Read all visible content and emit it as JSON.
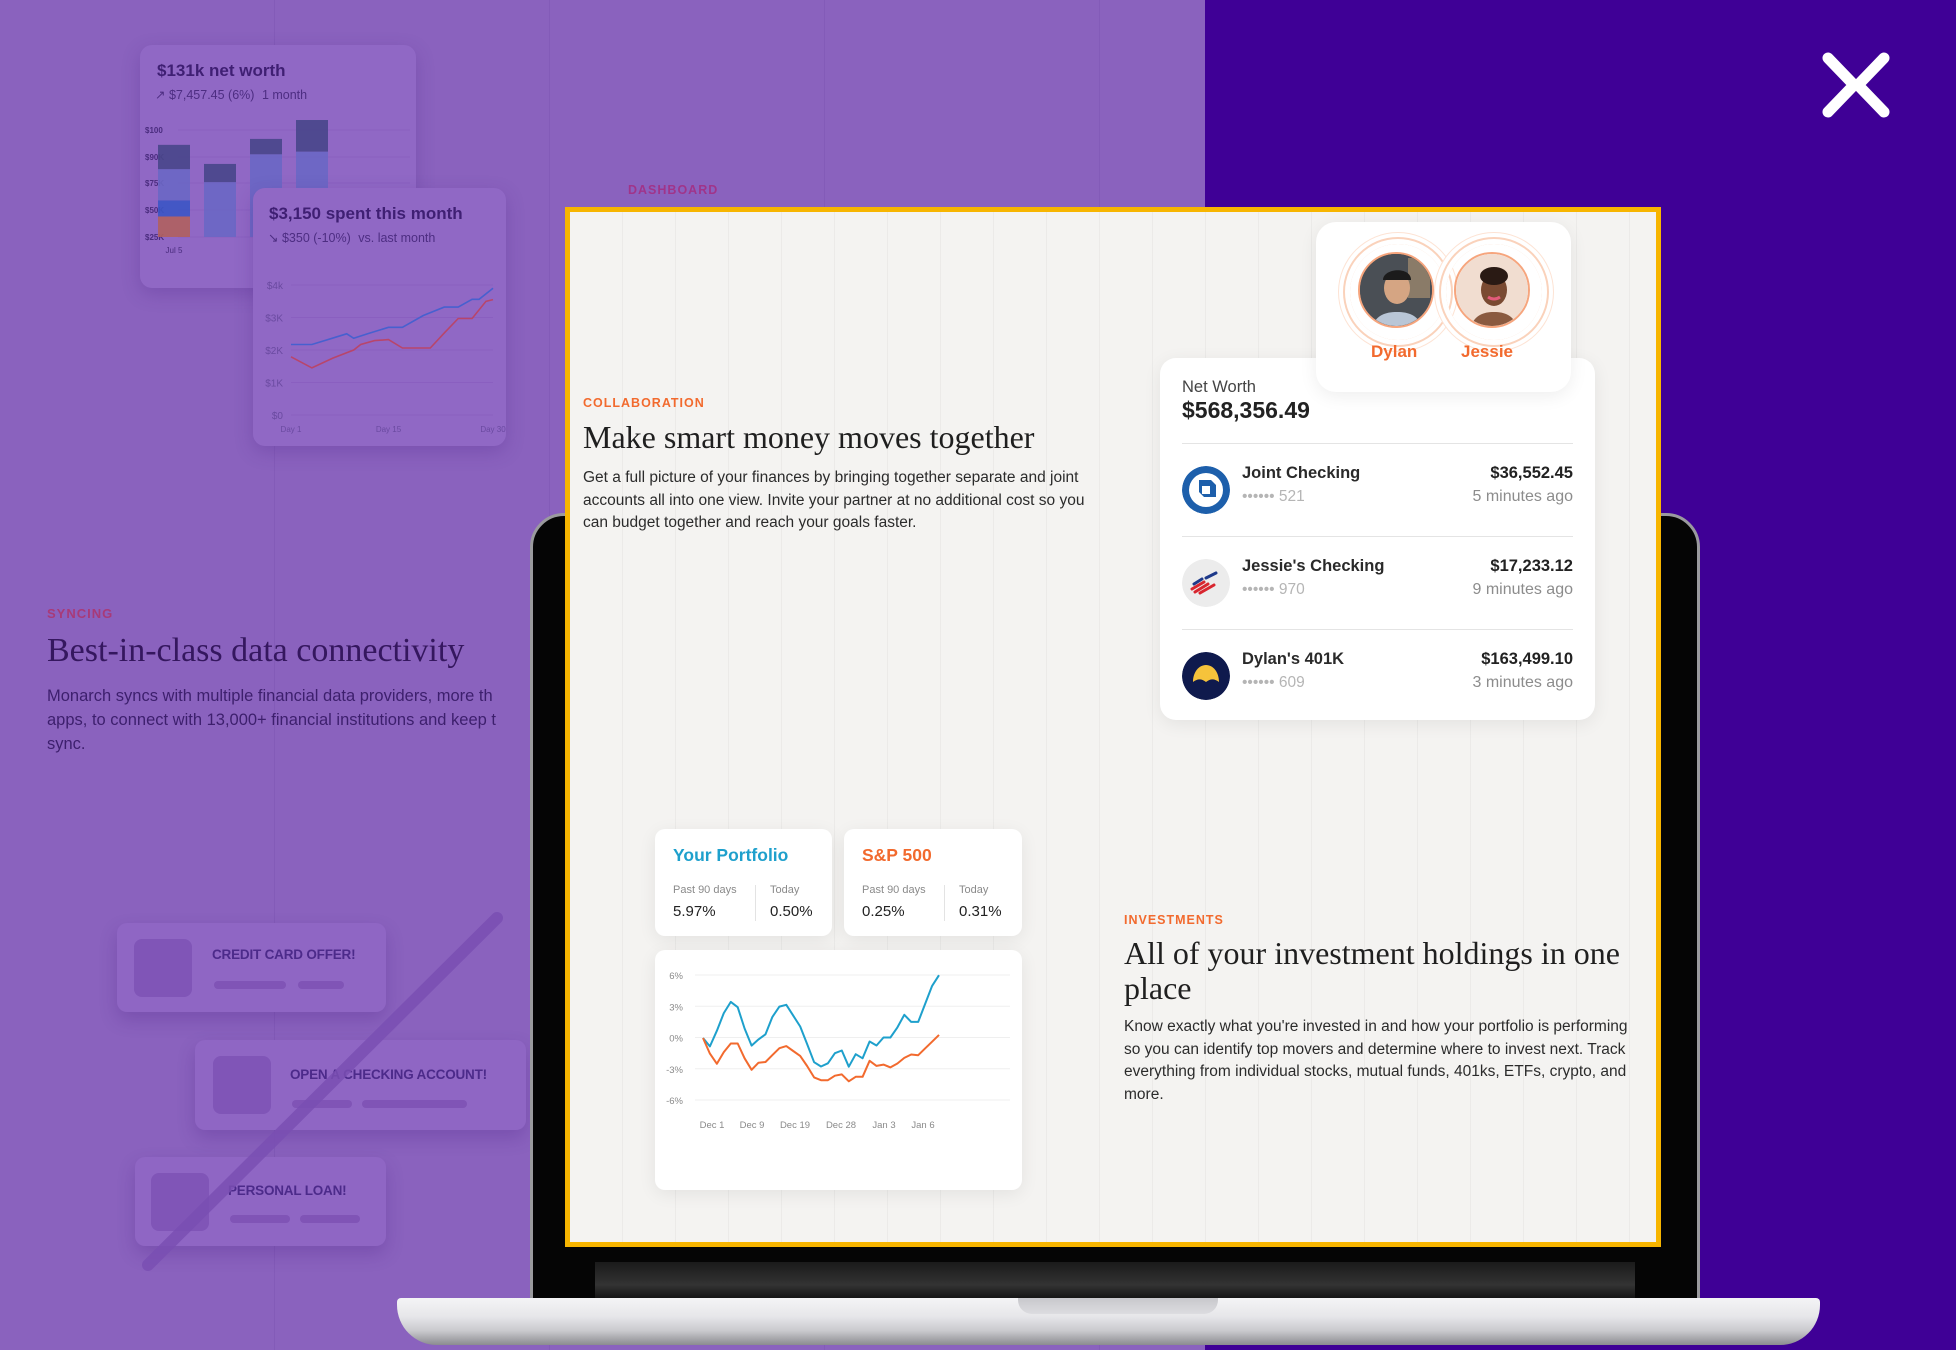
{
  "logo": {
    "name": "x-logo-icon",
    "color": "#ffffff"
  },
  "colors": {
    "left_background": "#8a62be",
    "right_background": "#3f0096",
    "highlight_border": "#f7b500",
    "accent_orange": "#f26a2e",
    "portfolio_blue": "#1ea0cc"
  },
  "background_page": {
    "net_worth_card": {
      "title": "$131k net worth",
      "change": "$7,457.45 (6%)",
      "period": "1 month",
      "change_icon": "arrow-up-right-icon"
    },
    "spent_card": {
      "title": "$3,150 spent this month",
      "change": "$350 (-10%)",
      "period": "vs. last month",
      "change_icon": "arrow-down-right-icon"
    },
    "dashboard_label": "DASHBOARD",
    "syncing": {
      "eyebrow": "SYNCING",
      "heading": "Best-in-class data connectivity",
      "body_lines": [
        "Monarch syncs with multiple financial data providers, more th",
        "apps, to connect with 13,000+ financial institutions and keep t",
        "sync."
      ]
    },
    "ads": [
      {
        "label": "CREDIT CARD OFFER!"
      },
      {
        "label": "OPEN A CHECKING ACCOUNT!"
      },
      {
        "label": "PERSONAL LOAN!"
      }
    ]
  },
  "screen": {
    "collaboration": {
      "eyebrow": "COLLABORATION",
      "heading": "Make smart money moves together",
      "body": "Get a full picture of your finances by bringing together separate and joint accounts all into one view. Invite your partner at no additional cost so you can budget together and reach your goals faster."
    },
    "partners": [
      {
        "name": "Dylan"
      },
      {
        "name": "Jessie"
      }
    ],
    "net_worth": {
      "label": "Net Worth",
      "value": "$568,356.49",
      "accounts": [
        {
          "name": "Joint Checking",
          "mask": "•••••• 521",
          "amount": "$36,552.45",
          "updated": "5 minutes ago",
          "icon": "chase-bank-icon"
        },
        {
          "name": "Jessie's Checking",
          "mask": "•••••• 970",
          "amount": "$17,233.12",
          "updated": "9 minutes ago",
          "icon": "bank-of-america-icon"
        },
        {
          "name": "Dylan's 401K",
          "mask": "•••••• 609",
          "amount": "$163,499.10",
          "updated": "3 minutes ago",
          "icon": "retirement-provider-icon"
        }
      ]
    },
    "performance": [
      {
        "title": "Your Portfolio",
        "color": "#1ea0cc",
        "past_label": "Past 90 days",
        "past_value": "5.97%",
        "today_label": "Today",
        "today_value": "0.50%"
      },
      {
        "title": "S&P 500",
        "color": "#f26a2e",
        "past_label": "Past 90 days",
        "past_value": "0.25%",
        "today_label": "Today",
        "today_value": "0.31%"
      }
    ],
    "investments": {
      "eyebrow": "INVESTMENTS",
      "heading": "All of your investment holdings in one place",
      "body": "Know exactly what you're invested in and how your portfolio is performing so you can identify top movers and determine where to invest next. Track everything from individual stocks, mutual funds, 401ks, ETFs, crypto, and more."
    }
  },
  "chart_data": [
    {
      "type": "line",
      "title": "",
      "x_ticks": [
        "Dec 1",
        "Dec 9",
        "Dec 19",
        "Dec 28",
        "Jan 3",
        "Jan 6"
      ],
      "y_ticks": [
        "6%",
        "3%",
        "0%",
        "-3%",
        "-6%"
      ],
      "ylim": [
        -6,
        6
      ],
      "grid": true,
      "series": [
        {
          "color": "#1ea0cc",
          "values": [
            -0.05,
            -0.85,
            0.65,
            2.34,
            3.42,
            2.91,
            0.86,
            -0.78,
            -0.18,
            0.31,
            1.98,
            2.97,
            3.14,
            2.1,
            1.06,
            -0.62,
            -2.37,
            -2.78,
            -2.48,
            -1.51,
            -1.25,
            -2.8,
            -1.6,
            -2.0,
            -0.38,
            -0.77,
            0,
            0,
            0.97,
            2.18,
            1.5,
            1.5,
            3.22,
            4.95,
            5.98
          ]
        },
        {
          "color": "#f26a2e",
          "values": [
            -0.05,
            -1.55,
            -2.52,
            -1.4,
            -0.58,
            -0.58,
            -2.0,
            -3.1,
            -2.42,
            -2.35,
            -1.69,
            -1.03,
            -0.83,
            -1.3,
            -1.77,
            -2.74,
            -3.83,
            -4.1,
            -4.1,
            -3.67,
            -3.54,
            -4.2,
            -3.77,
            -3.77,
            -2.24,
            -2.73,
            -2.6,
            -2.87,
            -2.5,
            -1.96,
            -1.63,
            -1.7,
            -1.05,
            -0.4,
            0.25
          ]
        }
      ]
    },
    {
      "type": "line",
      "title": "$3,150 spent this month",
      "x_ticks": [
        {
          "value": 1,
          "label": "Day 1"
        },
        {
          "value": 15,
          "label": "Day 15"
        },
        {
          "value": 30,
          "label": "Day 30"
        }
      ],
      "y_ticks": [
        {
          "value": 0,
          "label": "$0"
        },
        {
          "value": 1000,
          "label": "$1K"
        },
        {
          "value": 2000,
          "label": "$2K"
        },
        {
          "value": 3000,
          "label": "$3K"
        },
        {
          "value": 4000,
          "label": "$4k"
        }
      ],
      "xlim": [
        1,
        30
      ],
      "ylim": [
        0,
        4000
      ],
      "grid": true,
      "series": [
        {
          "color": "#3b5fd0",
          "x": [
            1,
            4,
            9,
            10,
            12,
            15,
            17,
            20,
            23,
            25,
            27,
            28,
            30
          ],
          "y": [
            2170,
            2170,
            2500,
            2360,
            2500,
            2700,
            2700,
            3060,
            3320,
            3320,
            3560,
            3560,
            3900
          ]
        },
        {
          "color": "#c0405a",
          "x": [
            1,
            4,
            7,
            10,
            11,
            13,
            15,
            17,
            21,
            23,
            25,
            27,
            29,
            30
          ],
          "y": [
            1790,
            1450,
            1750,
            2000,
            2170,
            2290,
            2320,
            2060,
            2060,
            2520,
            2970,
            2970,
            3500,
            3550
          ]
        }
      ]
    },
    {
      "type": "bar",
      "stacked": true,
      "title": "$131k net worth",
      "categories": [
        "Jul 5",
        "",
        "",
        ""
      ],
      "y_ticks": [
        {
          "value": 25000,
          "label": "$25K"
        },
        {
          "value": 50000,
          "label": "$50K"
        },
        {
          "value": 75000,
          "label": "$75K"
        },
        {
          "value": 90000,
          "label": "$90K"
        },
        {
          "value": 100000,
          "label": "$100"
        }
      ],
      "segment_colors": [
        "#b0605e",
        "#3b55c4",
        "#6a67c4",
        "#48468a"
      ],
      "stacks": [
        [
          25000,
          44000,
          59000,
          83000,
          94500
        ],
        [
          25000,
          25000,
          25000,
          75500,
          86000
        ],
        [
          25000,
          25000,
          25000,
          91000,
          96700
        ],
        [
          25000,
          25000,
          25000,
          92000,
          103700
        ]
      ]
    }
  ]
}
